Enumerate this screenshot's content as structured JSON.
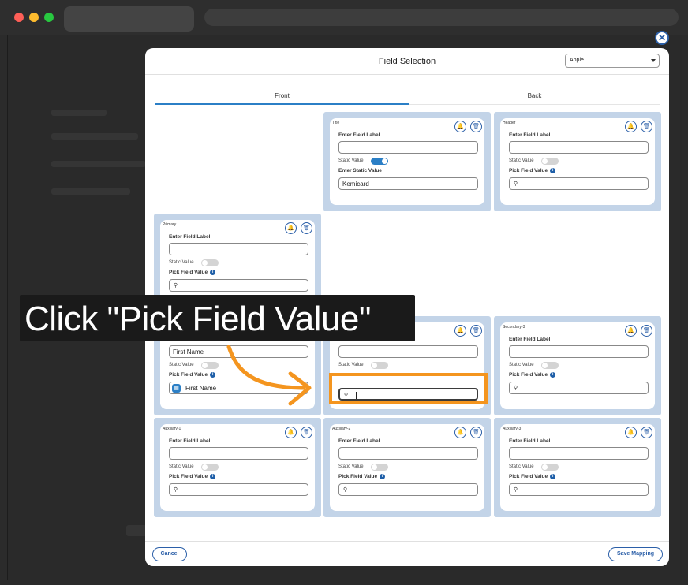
{
  "modal": {
    "title": "Field Selection",
    "dropdown_value": "Apple",
    "tabs": {
      "front": "Front",
      "back": "Back"
    },
    "footer": {
      "cancel": "Cancel",
      "save": "Save Mapping"
    }
  },
  "labels": {
    "enter_field_label": "Enter Field Label",
    "static_value": "Static Value",
    "enter_static_value": "Enter Static Value",
    "pick_field_value": "Pick Field Value"
  },
  "cards": {
    "title": {
      "tag": "Title",
      "static_on": true,
      "static_value": "Kemicard"
    },
    "header": {
      "tag": "Header"
    },
    "primary": {
      "tag": "Primary"
    },
    "secondary1": {
      "field_label": "First Name",
      "pick_value": "First Name"
    },
    "secondary3": {
      "tag": "Secondary-3"
    },
    "auxiliary1": {
      "tag": "Auxiliary-1"
    },
    "auxiliary2": {
      "tag": "Auxiliary-2"
    },
    "auxiliary3": {
      "tag": "Auxiliary-3"
    }
  },
  "callout": {
    "text": "Click \"Pick Field Value\""
  },
  "icons": [
    "bell-icon",
    "trash-icon",
    "search-icon",
    "info-icon",
    "close-icon",
    "chevron-down-icon",
    "field-type-icon"
  ],
  "colors": {
    "accent": "#2b7fc6",
    "highlight": "#f4951f",
    "cell_bg": "#c3d4e8"
  }
}
